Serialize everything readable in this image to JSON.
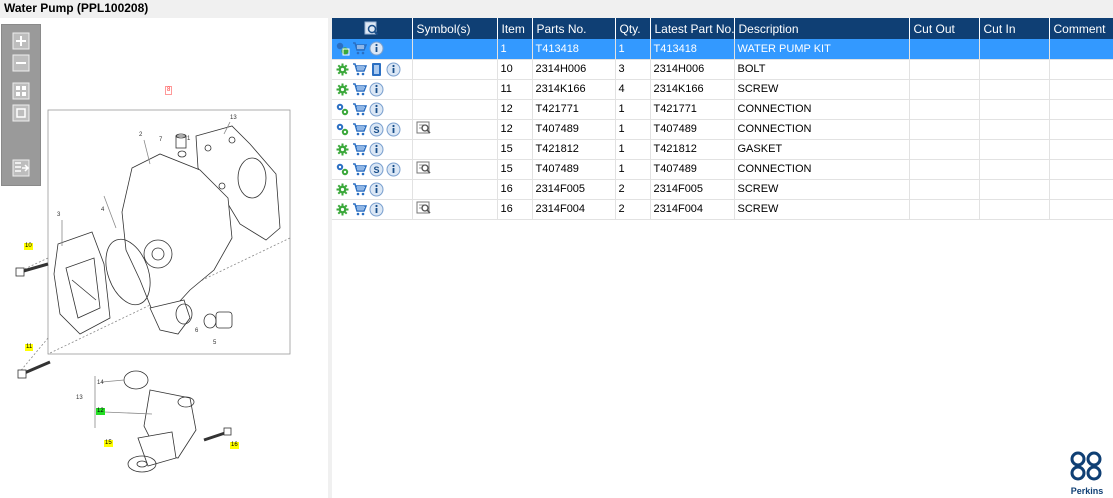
{
  "window": {
    "title": "Water Pump (PPL100208)"
  },
  "diagram": {
    "callouts": [
      {
        "label": "8",
        "style": "red"
      },
      {
        "label": "10",
        "style": "yellow"
      },
      {
        "label": "11",
        "style": "yellow"
      },
      {
        "label": "12",
        "style": "green"
      },
      {
        "label": "15",
        "style": "yellow"
      },
      {
        "label": "16",
        "style": "yellow"
      },
      {
        "label": "1",
        "style": "plain"
      },
      {
        "label": "2",
        "style": "plain"
      },
      {
        "label": "3",
        "style": "plain"
      },
      {
        "label": "4",
        "style": "plain"
      },
      {
        "label": "5",
        "style": "plain"
      },
      {
        "label": "6",
        "style": "plain"
      },
      {
        "label": "7",
        "style": "plain"
      },
      {
        "label": "9",
        "style": "plain"
      },
      {
        "label": "13",
        "style": "plain"
      },
      {
        "label": "14",
        "style": "plain"
      }
    ]
  },
  "toolbar": {
    "buttons": [
      "zoom-in-icon",
      "zoom-out-icon",
      "fit-all-icon",
      "fit-window-icon",
      "export-icon"
    ]
  },
  "table": {
    "headers": {
      "icon": "",
      "symbols": "Symbol(s)",
      "item": "Item",
      "parts_no": "Parts No.",
      "qty": "Qty.",
      "latest_part_no": "Latest Part No.",
      "description": "Description",
      "cut_out": "Cut Out",
      "cut_in": "Cut In",
      "comment": "Comment"
    },
    "rows": [
      {
        "item": "1",
        "parts_no": "T413418",
        "qty": "1",
        "latest_part_no": "T413418",
        "description": "WATER PUMP KIT",
        "cut_out": "",
        "cut_in": "",
        "comment": "",
        "selected": true,
        "icons": [
          "kit-gear-icon",
          "cart-icon",
          "info-icon"
        ],
        "symbol": ""
      },
      {
        "item": "10",
        "parts_no": "2314H006",
        "qty": "3",
        "latest_part_no": "2314H006",
        "description": "BOLT",
        "cut_out": "",
        "cut_in": "",
        "comment": "",
        "selected": false,
        "icons": [
          "gear-icon",
          "cart-icon",
          "book-icon",
          "info-icon"
        ],
        "symbol": ""
      },
      {
        "item": "11",
        "parts_no": "2314K166",
        "qty": "4",
        "latest_part_no": "2314K166",
        "description": "SCREW",
        "cut_out": "",
        "cut_in": "",
        "comment": "",
        "selected": false,
        "icons": [
          "gear-icon",
          "cart-icon",
          "info-icon"
        ],
        "symbol": ""
      },
      {
        "item": "12",
        "parts_no": "T421771",
        "qty": "1",
        "latest_part_no": "T421771",
        "description": "CONNECTION",
        "cut_out": "",
        "cut_in": "",
        "comment": "",
        "selected": false,
        "icons": [
          "gear-pair-icon",
          "cart-icon",
          "info-icon"
        ],
        "symbol": ""
      },
      {
        "item": "12",
        "parts_no": "T407489",
        "qty": "1",
        "latest_part_no": "T407489",
        "description": "CONNECTION",
        "cut_out": "",
        "cut_in": "",
        "comment": "",
        "selected": false,
        "icons": [
          "gear-pair-icon",
          "cart-icon",
          "s-badge-icon",
          "info-icon"
        ],
        "symbol": "drawing-view-icon"
      },
      {
        "item": "15",
        "parts_no": "T421812",
        "qty": "1",
        "latest_part_no": "T421812",
        "description": "GASKET",
        "cut_out": "",
        "cut_in": "",
        "comment": "",
        "selected": false,
        "icons": [
          "gear-icon",
          "cart-icon",
          "info-icon"
        ],
        "symbol": ""
      },
      {
        "item": "15",
        "parts_no": "T407489",
        "qty": "1",
        "latest_part_no": "T407489",
        "description": "CONNECTION",
        "cut_out": "",
        "cut_in": "",
        "comment": "",
        "selected": false,
        "icons": [
          "gear-pair-icon",
          "cart-icon",
          "s-badge-icon",
          "info-icon"
        ],
        "symbol": "drawing-view-icon"
      },
      {
        "item": "16",
        "parts_no": "2314F005",
        "qty": "2",
        "latest_part_no": "2314F005",
        "description": "SCREW",
        "cut_out": "",
        "cut_in": "",
        "comment": "",
        "selected": false,
        "icons": [
          "gear-icon",
          "cart-icon",
          "info-icon"
        ],
        "symbol": ""
      },
      {
        "item": "16",
        "parts_no": "2314F004",
        "qty": "2",
        "latest_part_no": "2314F004",
        "description": "SCREW",
        "cut_out": "",
        "cut_in": "",
        "comment": "",
        "selected": false,
        "icons": [
          "gear-icon",
          "cart-icon",
          "info-icon"
        ],
        "symbol": "drawing-view-icon"
      }
    ]
  },
  "logo": {
    "brand": "Perkins"
  },
  "colors": {
    "header_bg": "#0f3f74",
    "selected_row": "#3399ff",
    "highlight_yellow": "#ffff00",
    "highlight_green": "#22dd22"
  }
}
